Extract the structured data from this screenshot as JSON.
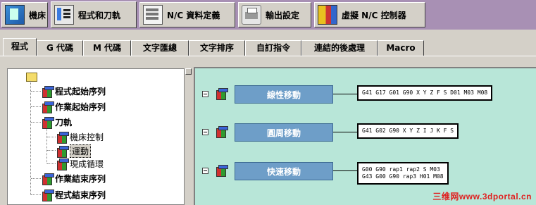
{
  "top_tabs": [
    {
      "label": "機床",
      "icon": "machine-icon"
    },
    {
      "label": "程式和刀軌",
      "icon": "program-path-icon"
    },
    {
      "label": "N/C 資料定義",
      "icon": "nc-data-icon"
    },
    {
      "label": "輸出設定",
      "icon": "output-settings-icon"
    },
    {
      "label": "虛擬 N/C 控制器",
      "icon": "virtual-nc-icon"
    }
  ],
  "sub_tabs": [
    {
      "label": "程式"
    },
    {
      "label": "G 代碼"
    },
    {
      "label": "M 代碼"
    },
    {
      "label": "文字匯總"
    },
    {
      "label": "文字排序"
    },
    {
      "label": "自訂指令"
    },
    {
      "label": "連結的後處理"
    },
    {
      "label": "Macro"
    }
  ],
  "tree": {
    "items": [
      {
        "label": "程式起始序列"
      },
      {
        "label": "作業起始序列"
      },
      {
        "label": "刀軌"
      },
      {
        "label": "機床控制"
      },
      {
        "label": "運動"
      },
      {
        "label": "現成循環"
      },
      {
        "label": "作業結束序列"
      },
      {
        "label": "程式結束序列"
      }
    ]
  },
  "motions": [
    {
      "label": "線性移動",
      "code": "G41 G17 G01 G90 X Y Z F S D01 M03 M08"
    },
    {
      "label": "圓周移動",
      "code": "G41 G02 G90 X Y Z I J K F S"
    },
    {
      "label": "快速移動",
      "code": "G00 G90 rap1 rap2 S M03\nG43 G00 G90 rap3 H01 M08"
    }
  ],
  "watermark": "三维网www.3dportal.cn",
  "colors": {
    "right_panel_bg": "#b8e6d8",
    "motion_button": "#6e9ec8",
    "toolbar_bg": "#a890b4"
  }
}
